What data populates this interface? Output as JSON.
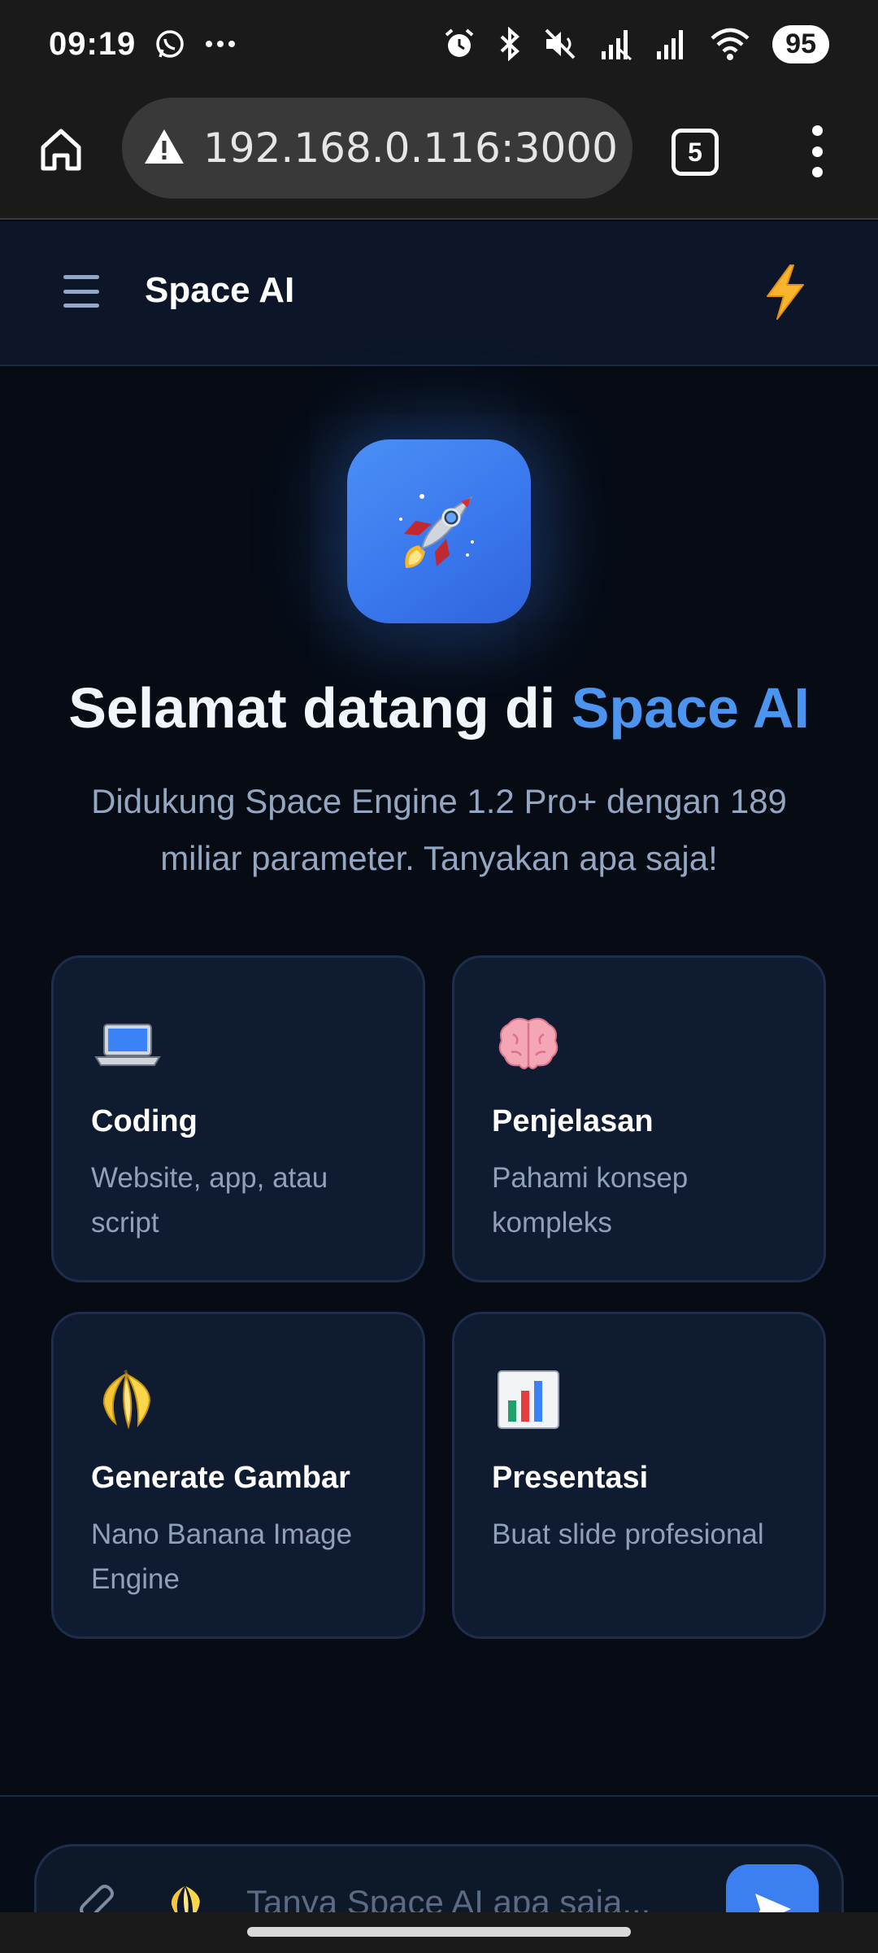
{
  "status_bar": {
    "time": "09:19",
    "battery": "95",
    "icons": [
      "whatsapp-icon",
      "more-dots-icon",
      "alarm-icon",
      "bluetooth-icon",
      "mute-icon",
      "signal-icon",
      "signal-icon",
      "wifi-icon"
    ]
  },
  "browser": {
    "url": "192.168.0.116:3000",
    "tab_count": "5",
    "icons": [
      "home-icon",
      "warning-icon",
      "tabs-icon",
      "menu-dots-icon"
    ]
  },
  "app": {
    "title": "Space AI",
    "menu_icon": "hamburger-icon",
    "action_icon": "lightning-icon"
  },
  "hero": {
    "logo_icon": "rocket-icon",
    "heading_prefix": "Selamat datang di ",
    "heading_accent": "Space AI",
    "subtitle": "Didukung Space Engine 1.2 Pro+ dengan 189 miliar parameter. Tanyakan apa saja!"
  },
  "cards": [
    {
      "icon": "laptop-icon",
      "title": "Coding",
      "description": "Website, app, atau script"
    },
    {
      "icon": "brain-icon",
      "title": "Penjelasan",
      "description": "Pahami konsep kompleks"
    },
    {
      "icon": "banana-icon",
      "title": "Generate Gambar",
      "description": "Nano Banana Image Engine"
    },
    {
      "icon": "bar-chart-icon",
      "title": "Presentasi",
      "description": "Buat slide profesional"
    }
  ],
  "composer": {
    "placeholder": "Tanya Space AI apa saja...",
    "icons": [
      "paperclip-icon",
      "banana-icon",
      "send-icon"
    ]
  },
  "colors": {
    "background": "#060b14",
    "accent": "#4b95f0",
    "card_bg": "#0f1b30",
    "muted_text": "#8fa0b8"
  }
}
